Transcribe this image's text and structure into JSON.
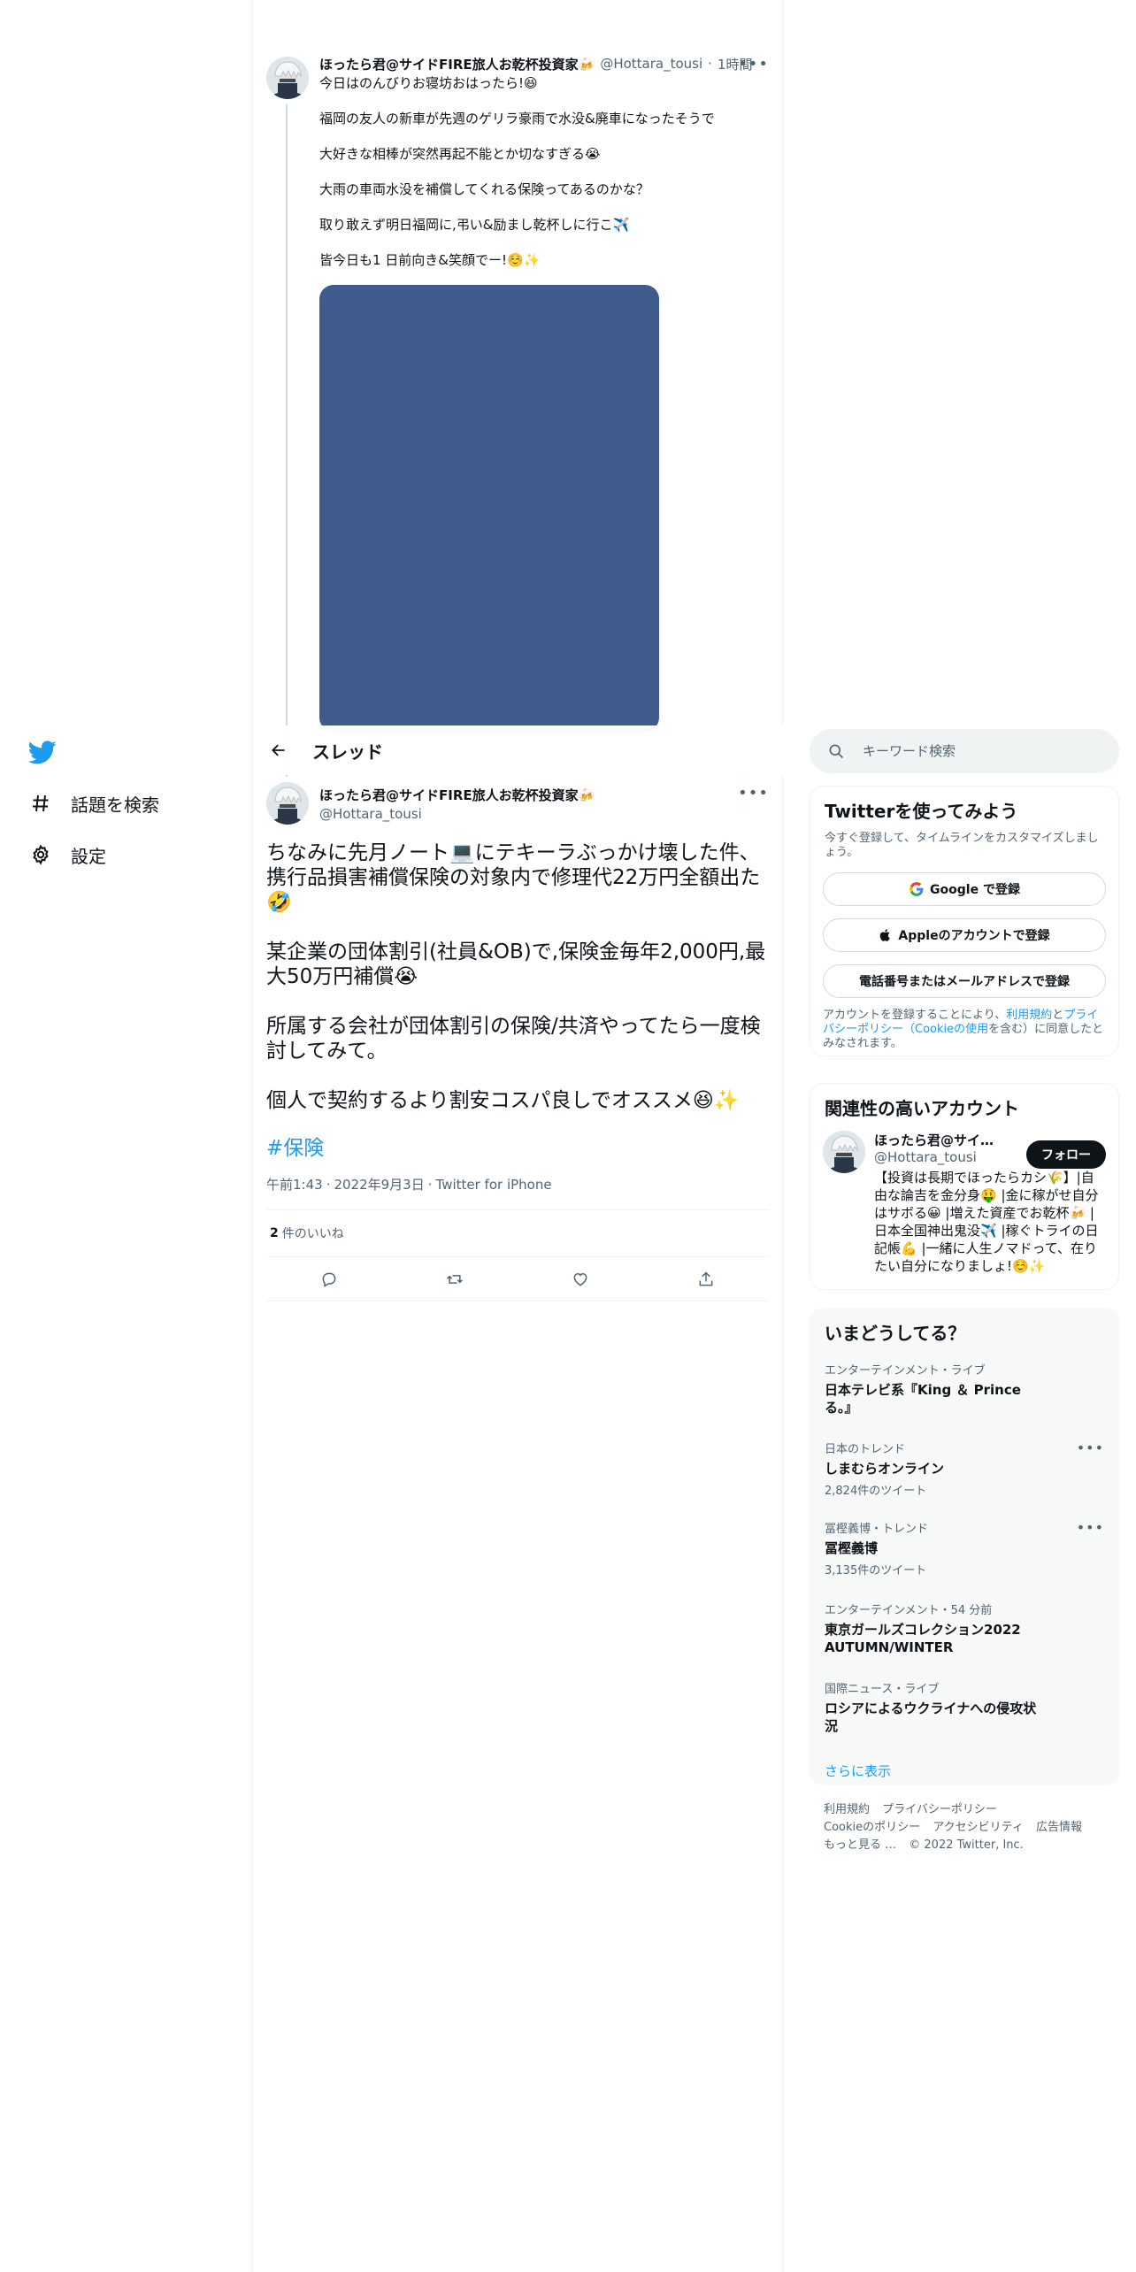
{
  "nav": {
    "explore_label": "話題を検索",
    "settings_label": "設定"
  },
  "parent_tweet": {
    "name": "ほったら君@サイドFIRE旅人お乾杯投資家🍻",
    "handle": "@Hottara_tousi",
    "time": "1時間",
    "lines": [
      "今日はのんびりお寝坊おはったら!😆",
      "福岡の友人の新車が先週のゲリラ豪雨で水没&廃車になったそうで",
      "大好きな相棒が突然再起不能とか切なすぎる😭",
      "大雨の車両水没を補償してくれる保険ってあるのかな？",
      "取り敢えず明日福岡に,弔い&励まし乾杯しに行こ✈️",
      "皆今日も1 日前向き&笑顔でー!☺️✨"
    ]
  },
  "header": {
    "title": "スレッド"
  },
  "focal_tweet": {
    "name": "ほったら君@サイドFIRE旅人お乾杯投資家🍻",
    "handle": "@Hottara_tousi",
    "paragraphs": [
      "ちなみに先月ノート💻にテキーラぶっかけ壊した件、携行品損害補償保険の対象内で修理代22万円全額出た🤣",
      "某企業の団体割引(社員&OB)で,保険金毎年2,000円,最大50万円補償😭",
      "所属する会社が団体割引の保険/共済やってたら一度検討してみて。",
      "個人で契約するより割安コスパ良しでオススメ😆✨"
    ],
    "hashtag": "#保険",
    "time": "午前1:43",
    "date": "2022年9月3日",
    "source": "Twitter for iPhone",
    "likes_count": "2",
    "likes_label": "件のいいね"
  },
  "search": {
    "placeholder": "キーワード検索"
  },
  "signup": {
    "title": "Twitterを使ってみよう",
    "subtitle": "今すぐ登録して、タイムラインをカスタマイズしましょう。",
    "google_label": "Google で登録",
    "apple_label": "Appleのアカウントで登録",
    "phone_label": "電話番号またはメールアドレスで登録",
    "legal_prefix": "アカウントを登録することにより、",
    "terms_link": "利用規約",
    "legal_and": "と",
    "privacy_link": "プライバシーポリシー（Cookieの使用",
    "legal_suffix": "を含む）に同意したとみなされます。"
  },
  "related": {
    "title": "関連性の高いアカウント",
    "name": "ほったら君@サイドFIRE旅人お乾杯投資家🍻",
    "handle": "@Hottara_tousi",
    "follow_label": "フォロー",
    "bio": "【投資は長期でほったらカシ🌾】|自由な論吉を金分身🤑 |金に稼がせ自分はサボる😀 |増えた資産でお乾杯🍻 |日本全国神出鬼没✈️ |稼ぐトライの日記帳💪 |一緒に人生ノマドって、在りたい自分になりましょ!☺️✨"
  },
  "trends": {
    "title": "いまどうしてる？",
    "items": [
      {
        "category": "エンターテインメント・ライブ",
        "title": "日本テレビ系『King ＆ Prince る。』",
        "count": ""
      },
      {
        "category": "日本のトレンド",
        "title": "しまむらオンライン",
        "count": "2,824件のツイート"
      },
      {
        "category": "冨樫義博・トレンド",
        "title": "冨樫義博",
        "count": "3,135件のツイート"
      },
      {
        "category": "エンターテインメント・54 分前",
        "title": "東京ガールズコレクション2022 AUTUMN/WINTER",
        "count": ""
      },
      {
        "category": "国際ニュース・ライブ",
        "title": "ロシアによるウクライナへの侵攻状況",
        "count": ""
      }
    ],
    "show_more": "さらに表示"
  },
  "footer": {
    "links": [
      "利用規約",
      "プライバシーポリシー",
      "Cookieのポリシー",
      "アクセシビリティ",
      "広告情報",
      "もっと見る …"
    ],
    "copyright": "© 2022 Twitter, Inc."
  },
  "colors": {
    "accent": "#1d9bf0",
    "media_placeholder": "#3f5b8c",
    "text_primary": "#0f1419",
    "text_secondary": "#536471"
  }
}
